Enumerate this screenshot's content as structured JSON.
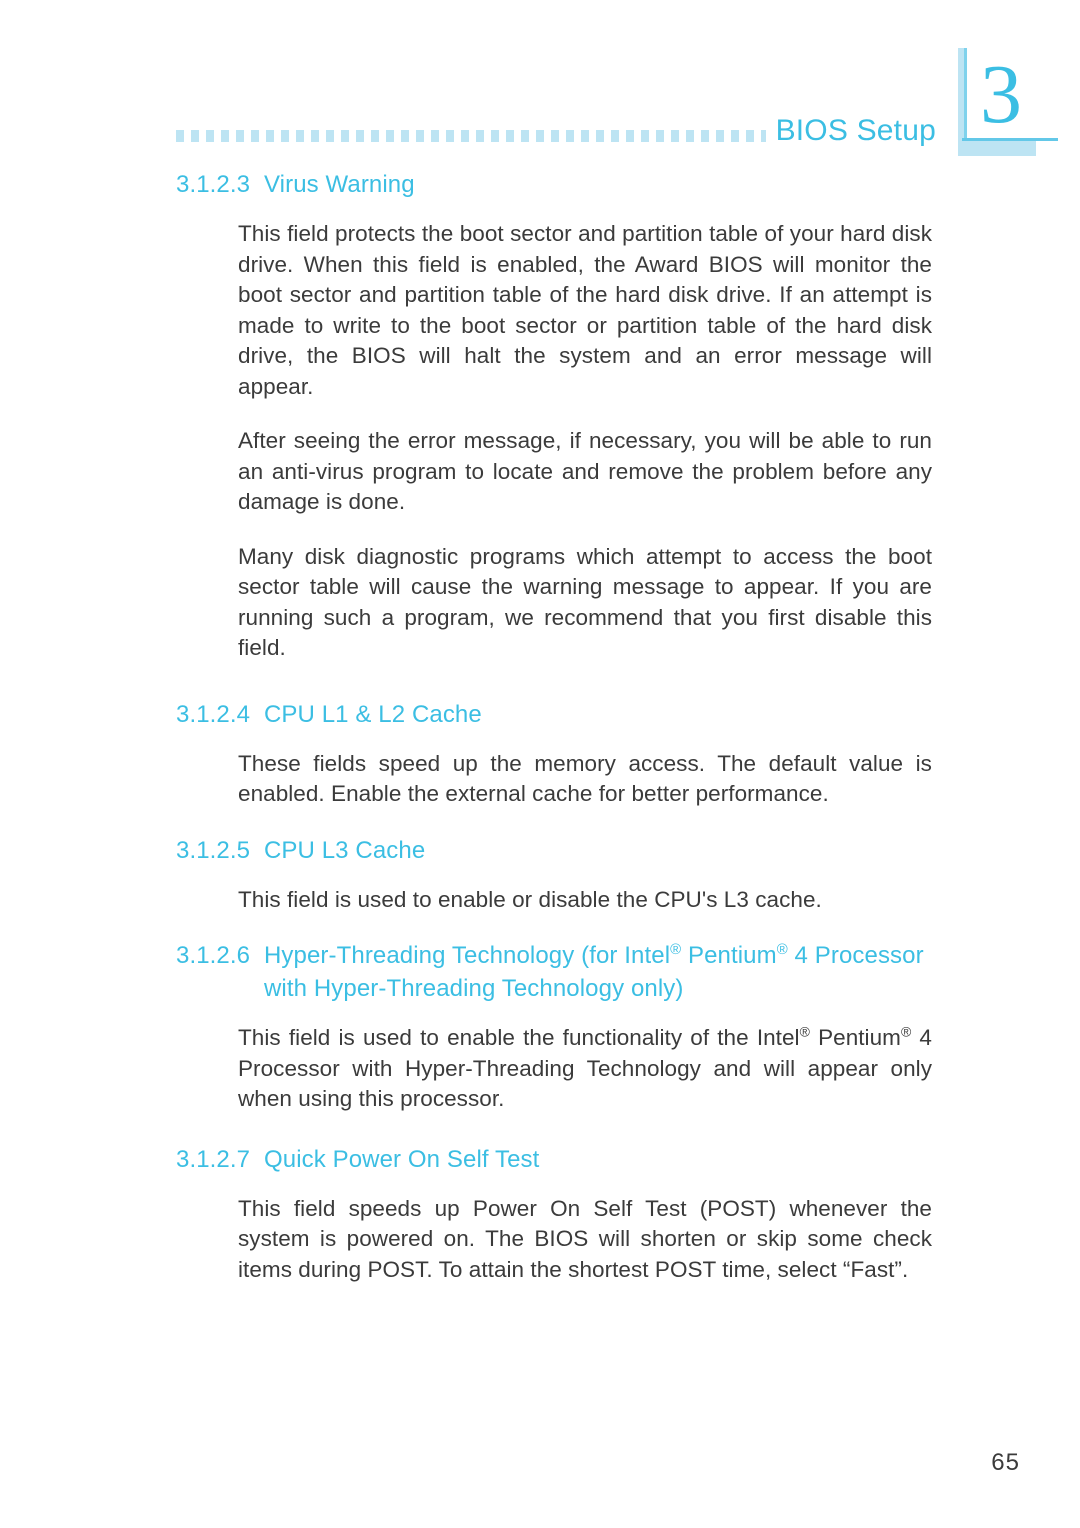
{
  "header": {
    "title": "BIOS Setup",
    "chapter_number": "3",
    "rule_style": "dotted-squares",
    "accent_color": "#3bbee3",
    "rule_color": "#bde4f3"
  },
  "sections": [
    {
      "number": "3.1.2.3",
      "title": "Virus Warning",
      "paragraphs": [
        "This field protects the boot sector and partition table of your hard disk drive. When this field is enabled, the Award BIOS will monitor the boot sector and partition table of the hard disk drive. If an attempt is made to write to the boot sector or partition table of the hard disk drive, the BIOS will halt the system and an error message will appear.",
        "After seeing the error message, if necessary, you will be able to run an anti-virus program to locate and remove the problem before any damage is done.",
        "Many disk diagnostic programs which attempt to access the boot sector table will cause the warning message to appear. If you are running such a program, we recommend that you first disable this field."
      ]
    },
    {
      "number": "3.1.2.4",
      "title": "CPU L1 & L2 Cache",
      "paragraphs": [
        "These fields speed up the memory access. The default value is enabled. Enable the external cache for better performance."
      ]
    },
    {
      "number": "3.1.2.5",
      "title": "CPU L3 Cache",
      "paragraphs": [
        "This field is used to enable or disable the CPU's L3 cache."
      ]
    },
    {
      "number": "3.1.2.6",
      "title_line1_pre": "Hyper-Threading Technology (for Intel",
      "title_line1_mid": " Pentium",
      "title_line1_post": " 4 Processor",
      "title_line2": "with Hyper-Threading Technology only)",
      "registered_mark": "®",
      "paragraph_pre": "This field is used to enable the functionality of the Intel",
      "paragraph_mid": " Pentium",
      "paragraph_post": " 4 Processor with Hyper-Threading Technology and will appear only when using this processor."
    },
    {
      "number": "3.1.2.7",
      "title": "Quick Power On Self Test",
      "paragraphs": [
        "This field speeds up Power On Self Test (POST) whenever the system is powered on. The BIOS will shorten or skip some check items during POST. To attain the shortest POST time, select “Fast”."
      ]
    }
  ],
  "footer": {
    "page_number": "65"
  }
}
